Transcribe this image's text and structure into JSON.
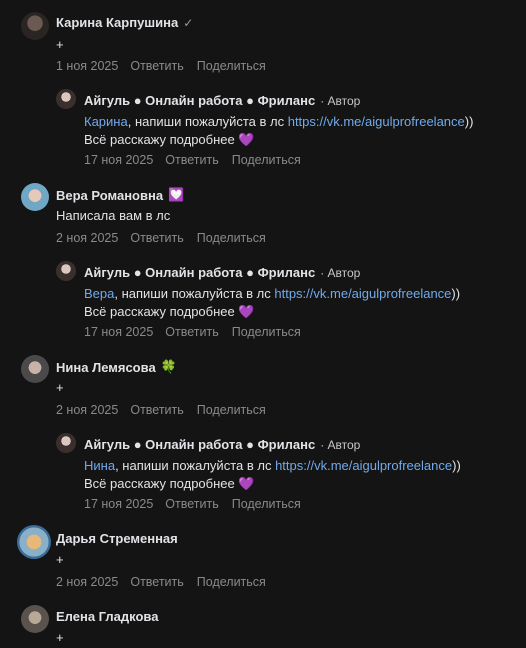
{
  "actions": {
    "reply": "Ответить",
    "share": "Поделиться"
  },
  "badges": {
    "author": "· Автор"
  },
  "comments": [
    {
      "author": "Карина Карпушина",
      "text": "+",
      "date": "1 ноя 2025",
      "reply": {
        "author": "Айгуль ● Онлайн работа ● Фриланс",
        "mention": "Карина",
        "text_mid": ", напиши пожалуйста в лс ",
        "link": "https://vk.me/aigulprofreelance",
        "text_end": "))",
        "line2": "Всё расскажу подробнее 💜",
        "date": "17 ноя 2025"
      }
    },
    {
      "author": "Вера Романовна",
      "text": "Написала вам в лс",
      "date": "2 ноя 2025",
      "reply": {
        "author": "Айгуль ● Онлайн работа ● Фриланс",
        "mention": "Вера",
        "text_mid": ", напиши пожалуйста в лс ",
        "link": "https://vk.me/aigulprofreelance",
        "text_end": "))",
        "line2": "Всё расскажу подробнее 💜",
        "date": "17 ноя 2025"
      }
    },
    {
      "author": "Нина Лемясова",
      "text": "+",
      "date": "2 ноя 2025",
      "reply": {
        "author": "Айгуль ● Онлайн работа ● Фриланс",
        "mention": "Нина",
        "text_mid": ", напиши пожалуйста в лс ",
        "link": "https://vk.me/aigulprofreelance",
        "text_end": "))",
        "line2": "Всё расскажу подробнее 💜",
        "date": "17 ноя 2025"
      }
    },
    {
      "author": "Дарья Стременная",
      "text": "+",
      "date": "2 ноя 2025"
    },
    {
      "author": "Елена Гладкова",
      "text": "+"
    }
  ],
  "icons": {
    "verified": "✓",
    "vera_badge": "💟",
    "nina_badge": "🍀"
  }
}
